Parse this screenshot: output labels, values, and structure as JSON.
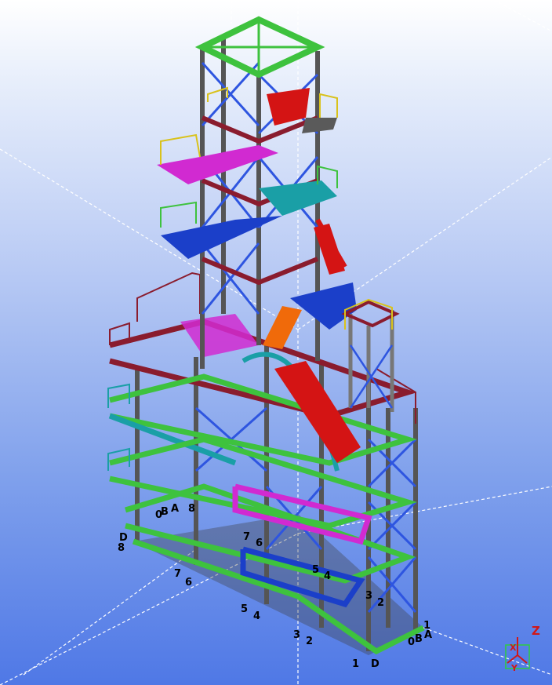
{
  "window": {
    "title": ""
  },
  "grid_labels": {
    "line_1_front": "1",
    "line_D_front": "D",
    "line_2_front": "2",
    "line_3_front": "3",
    "line_4_front": "4",
    "line_5_front": "5",
    "line_6_front": "6",
    "line_7_front": "7",
    "line_8_left": "8",
    "line_D_left": "D",
    "line_A_right": "A",
    "line_B_right": "B",
    "line_0_right": "0",
    "line_1_right": "1",
    "line_A_back": "A",
    "line_8_back": "8",
    "line_B_back": "B",
    "line_0_back": "0",
    "mid_7": "7",
    "mid_6": "6",
    "mid_5": "5",
    "mid_4": "4",
    "mid_3": "3",
    "mid_2": "2"
  },
  "axis_triad": {
    "z_label": "Z",
    "x_label": "X",
    "y_label": "Y"
  },
  "colors": {
    "column_steel": "#5a5a5a",
    "maroon_beam": "#8a1c2e",
    "green_beam": "#3ec23e",
    "blue_beam": "#1b3fc9",
    "magenta_beam": "#d12ad1",
    "cyan_beam": "#1a9fa6",
    "red_beam": "#d41414",
    "orange_stair": "#f06a0a",
    "yellow_rail": "#d9c21c",
    "bracing_blue": "#2e55e0",
    "grid_line": "#ffffff"
  }
}
